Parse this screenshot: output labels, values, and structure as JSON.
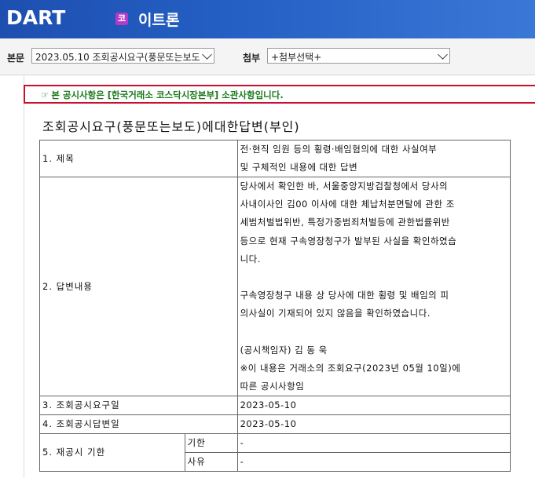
{
  "header": {
    "logo": "DART",
    "app_icon_char": "코",
    "app_title": "이트론"
  },
  "toolbar": {
    "main_label": "본문",
    "main_select": "2023.05.10  조회공시요구(풍문또는보도",
    "attach_label": "첨부",
    "attach_select": "+첨부선택+"
  },
  "notice": {
    "hand": "☞",
    "text": "본 공시사항은 [한국거래소 코스닥시장본부] 소관사항입니다."
  },
  "doc_title": "조회공시요구(풍문또는보도)에대한답변(부인)",
  "table": {
    "row1_label": "1. 제목",
    "row1_line1": "전·현직 임원 등의 횡령·배임혐의에 대한 사실여부",
    "row1_line2": "및 구체적인 내용에 대한 답변",
    "row2_label": "2. 답변내용",
    "row2_lines": [
      "당사에서 확인한 바, 서울중앙지방검찰청에서 당사의",
      "사내이사인 김00 이사에 대한 체납처분면탈에 관한 조",
      "세범처벌법위반, 특정가중범죄처벌등에 관한법률위반",
      "등으로 현재 구속영장청구가 발부된 사실을 확인하였습",
      "니다.",
      "",
      "구속영장청구 내용 상 당사에 대한 횡령 및 배임의 피",
      "의사실이 기재되어 있지 않음을 확인하였습니다.",
      "",
      "(공시책임자) 김 동 욱",
      "※이 내용은 거래소의 조회요구(2023년 05월 10일)에",
      "따른 공시사항임"
    ],
    "row3_label": "3. 조회공시요구일",
    "row3_value": "2023-05-10",
    "row4_label": "4. 조회공시답변일",
    "row4_value": "2023-05-10",
    "row5_label": "5. 재공시 기한",
    "row5_sub1_label": "기한",
    "row5_sub1_value": "-",
    "row5_sub2_label": "사유",
    "row5_sub2_value": "-"
  }
}
